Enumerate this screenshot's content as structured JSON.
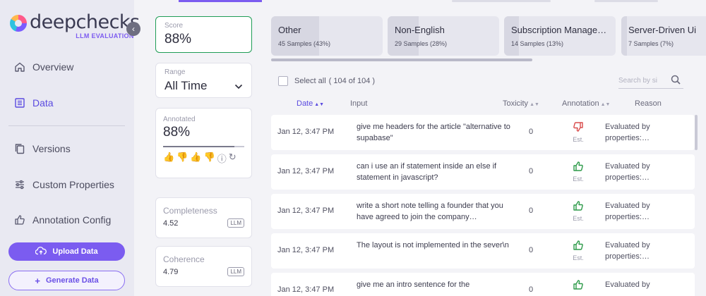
{
  "brand": {
    "name": "deepchecks",
    "sub": "LLM EVALUATION"
  },
  "nav": {
    "overview": "Overview",
    "data": "Data",
    "versions": "Versions",
    "custom_properties": "Custom Properties",
    "annotation_config": "Annotation Config"
  },
  "actions": {
    "upload": "Upload Data",
    "generate": "Generate Data"
  },
  "panel": {
    "score_label": "Score",
    "score_value": "88%",
    "range_label": "Range",
    "range_value": "All Time",
    "annotated_label": "Annotated",
    "annotated_value": "88%",
    "annotated_fraction": 0.88,
    "completeness_label": "Completeness",
    "completeness_value": "4.52",
    "coherence_label": "Coherence",
    "coherence_value": "4.79",
    "llm_badge": "LLM"
  },
  "categories": [
    {
      "title": "Other",
      "samples": "45 Samples (43%)",
      "fraction": 0.43
    },
    {
      "title": "Non-English",
      "samples": "29 Samples (28%)",
      "fraction": 0.28
    },
    {
      "title": "Subscription Manage…",
      "samples": "14 Samples (13%)",
      "fraction": 0.13
    },
    {
      "title": "Server-Driven Ui",
      "samples": "7 Samples (7%)",
      "fraction": 0.07
    }
  ],
  "table": {
    "select_all": "Select all",
    "select_count": "( 104 of 104 )",
    "search_placeholder": "Search by si",
    "headers": {
      "date": "Date",
      "input": "Input",
      "toxicity": "Toxicity",
      "annotation": "Annotation",
      "reason": "Reason"
    },
    "est_label": "Est.",
    "rows": [
      {
        "date": "Jan 12, 3:47 PM",
        "input": "give me headers for the article \"alternative to supabase\"",
        "toxicity": "0",
        "annotation": "bad",
        "reason": "Evaluated by properties:…"
      },
      {
        "date": "Jan 12, 3:47 PM",
        "input": "can i use an if statement inside an else if statement in javascript?",
        "toxicity": "0",
        "annotation": "good",
        "reason": "Evaluated by properties:…"
      },
      {
        "date": "Jan 12, 3:47 PM",
        "input": "write a short note telling a founder that you have agreed to join the company…",
        "toxicity": "0",
        "annotation": "good",
        "reason": "Evaluated by properties:…"
      },
      {
        "date": "Jan 12, 3:47 PM",
        "input": "The layout is not implemented in the sever\\n",
        "toxicity": "0",
        "annotation": "good",
        "reason": "Evaluated by properties:…"
      },
      {
        "date": "Jan 12, 3:47 PM",
        "input": "give me an intro sentence for the",
        "toxicity": "0",
        "annotation": "good",
        "reason": "Evaluated by"
      }
    ]
  },
  "colors": {
    "accent": "#7b5cf0",
    "score_border": "#1f9d56",
    "good": "#2e9b4a",
    "bad": "#d94b4b"
  }
}
